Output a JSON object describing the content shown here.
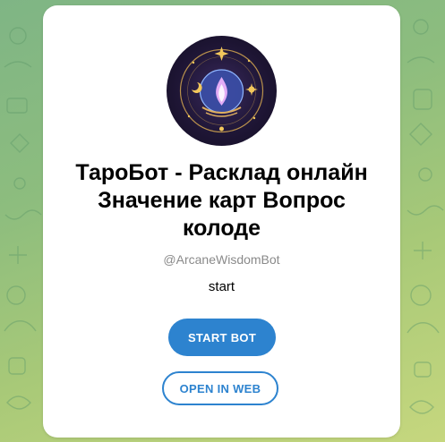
{
  "bot": {
    "name": "ТароБот - Расклад онлайн Значение карт Вопрос колоде",
    "username": "@ArcaneWisdomBot",
    "description": "start",
    "avatar_icon": "crystal-ball-tarot-icon"
  },
  "actions": {
    "start_label": "START BOT",
    "open_web_label": "OPEN IN WEB"
  },
  "colors": {
    "accent": "#2d83cf",
    "card_bg": "#ffffff",
    "muted_text": "#8a8a8a"
  }
}
